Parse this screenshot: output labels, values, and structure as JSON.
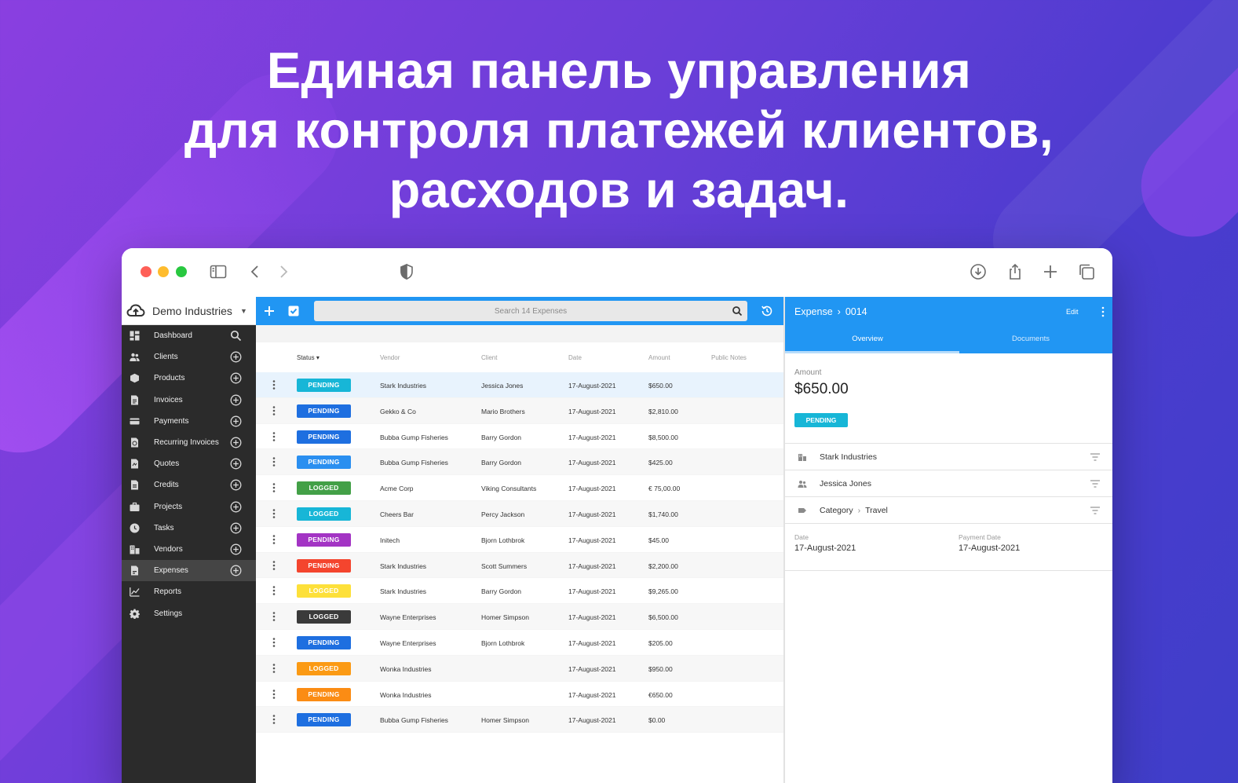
{
  "headline": {
    "line1": "Единая панель управления",
    "line2": "для контроля платежей клиентов,",
    "line3": "расходов и задач."
  },
  "browser": {
    "toolbar_icons": [
      "sidebar-icon",
      "back-icon",
      "forward-icon",
      "shield-icon",
      "download-icon",
      "share-icon",
      "new-tab-icon",
      "tabs-icon"
    ]
  },
  "company": {
    "name": "Demo Industries"
  },
  "sidebar": {
    "items": [
      {
        "label": "Dashboard",
        "icon": "dashboard-icon",
        "action": "search-icon"
      },
      {
        "label": "Clients",
        "icon": "clients-icon",
        "action": "add-icon"
      },
      {
        "label": "Products",
        "icon": "products-icon",
        "action": "add-icon"
      },
      {
        "label": "Invoices",
        "icon": "invoices-icon",
        "action": "add-icon"
      },
      {
        "label": "Payments",
        "icon": "payments-icon",
        "action": "add-icon"
      },
      {
        "label": "Recurring Invoices",
        "icon": "recurring-icon",
        "action": "add-icon"
      },
      {
        "label": "Quotes",
        "icon": "quotes-icon",
        "action": "add-icon"
      },
      {
        "label": "Credits",
        "icon": "credits-icon",
        "action": "add-icon"
      },
      {
        "label": "Projects",
        "icon": "projects-icon",
        "action": "add-icon"
      },
      {
        "label": "Tasks",
        "icon": "tasks-icon",
        "action": "add-icon"
      },
      {
        "label": "Vendors",
        "icon": "vendors-icon",
        "action": "add-icon"
      },
      {
        "label": "Expenses",
        "icon": "expenses-icon",
        "action": "add-icon"
      },
      {
        "label": "Reports",
        "icon": "reports-icon",
        "action": ""
      },
      {
        "label": "Settings",
        "icon": "settings-icon",
        "action": ""
      }
    ],
    "active": "Expenses"
  },
  "list": {
    "search_placeholder": "Search 14 Expenses",
    "columns": {
      "status": "Status",
      "vendor": "Vendor",
      "client": "Client",
      "date": "Date",
      "amount": "Amount",
      "notes": "Public Notes"
    },
    "rows": [
      {
        "status": "PENDING",
        "color": "#17b6d7",
        "vendor": "Stark Industries",
        "client": "Jessica Jones",
        "date": "17-August-2021",
        "amount": "$650.00"
      },
      {
        "status": "PENDING",
        "color": "#1e6fe0",
        "vendor": "Gekko & Co",
        "client": "Mario Brothers",
        "date": "17-August-2021",
        "amount": "$2,810.00"
      },
      {
        "status": "PENDING",
        "color": "#1e6fe0",
        "vendor": "Bubba Gump Fisheries",
        "client": "Barry Gordon",
        "date": "17-August-2021",
        "amount": "$8,500.00"
      },
      {
        "status": "PENDING",
        "color": "#2a8ff0",
        "vendor": "Bubba Gump Fisheries",
        "client": "Barry Gordon",
        "date": "17-August-2021",
        "amount": "$425.00"
      },
      {
        "status": "LOGGED",
        "color": "#43a047",
        "vendor": "Acme Corp",
        "client": "Viking Consultants",
        "date": "17-August-2021",
        "amount": "€ 75,00.00"
      },
      {
        "status": "LOGGED",
        "color": "#17b6d7",
        "vendor": "Cheers Bar",
        "client": "Percy Jackson",
        "date": "17-August-2021",
        "amount": "$1,740.00"
      },
      {
        "status": "PENDING",
        "color": "#a334c4",
        "vendor": "Initech",
        "client": "Bjorn Lothbrok",
        "date": "17-August-2021",
        "amount": "$45.00"
      },
      {
        "status": "PENDING",
        "color": "#f4452e",
        "vendor": "Stark Industries",
        "client": "Scott Summers",
        "date": "17-August-2021",
        "amount": "$2,200.00"
      },
      {
        "status": "LOGGED",
        "color": "#fde03a",
        "vendor": "Stark Industries",
        "client": "Barry Gordon",
        "date": "17-August-2021",
        "amount": "$9,265.00"
      },
      {
        "status": "LOGGED",
        "color": "#3a3a3a",
        "vendor": "Wayne Enterprises",
        "client": "Homer Simpson",
        "date": "17-August-2021",
        "amount": "$6,500.00"
      },
      {
        "status": "PENDING",
        "color": "#1e6fe0",
        "vendor": "Wayne Enterprises",
        "client": "Bjorn Lothbrok",
        "date": "17-August-2021",
        "amount": "$205.00"
      },
      {
        "status": "LOGGED",
        "color": "#fb9a14",
        "vendor": "Wonka Industries",
        "client": "",
        "date": "17-August-2021",
        "amount": "$950.00"
      },
      {
        "status": "PENDING",
        "color": "#fb8c14",
        "vendor": "Wonka Industries",
        "client": "",
        "date": "17-August-2021",
        "amount": "€650.00"
      },
      {
        "status": "PENDING",
        "color": "#1e6fe0",
        "vendor": "Bubba Gump Fisheries",
        "client": "Homer Simpson",
        "date": "17-August-2021",
        "amount": "$0.00"
      }
    ]
  },
  "detail": {
    "title": "Expense",
    "number": "0014",
    "edit_label": "Edit",
    "tabs": [
      "Overview",
      "Documents"
    ],
    "amount_label": "Amount",
    "amount_value": "$650.00",
    "status": "PENDING",
    "vendor": "Stark Industries",
    "client": "Jessica Jones",
    "category_label": "Category",
    "category_value": "Travel",
    "date_label": "Date",
    "date_value": "17-August-2021",
    "payment_date_label": "Payment Date",
    "payment_date_value": "17-August-2021"
  },
  "colors": {
    "accent": "#2196f3",
    "sidebar": "#2b2b2b",
    "pending_cyan": "#17b6d7"
  }
}
